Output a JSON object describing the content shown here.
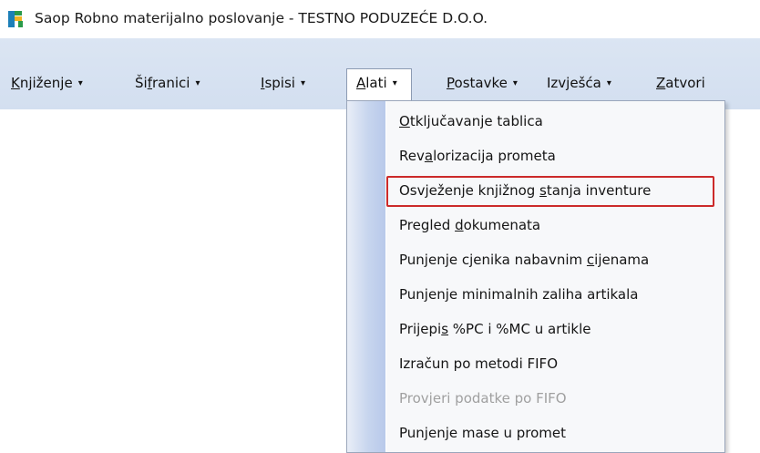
{
  "window": {
    "title": "Saop  Robno materijalno poslovanje - TESTNO PODUZEĆE D.O.O.",
    "accent_color": "#d6e1f1"
  },
  "menubar": {
    "items": [
      {
        "pre": "",
        "key": "K",
        "post": "njiženje",
        "arrow": "▾"
      },
      {
        "pre": "Ši",
        "key": "f",
        "post": "ranici",
        "arrow": "▾"
      },
      {
        "pre": "",
        "key": "I",
        "post": "spisi",
        "arrow": "▾"
      },
      {
        "pre": "",
        "key": "A",
        "post": "lati",
        "arrow": "▾"
      },
      {
        "pre": "",
        "key": "P",
        "post": "ostavke",
        "arrow": "▾"
      },
      {
        "pre": "Izvješća",
        "key": "",
        "post": "",
        "arrow": "▾"
      },
      {
        "pre": "",
        "key": "Z",
        "post": "atvori",
        "arrow": ""
      }
    ]
  },
  "dropdown": {
    "items": [
      {
        "pre": "",
        "key": "O",
        "post": "tključavanje tablica",
        "disabled": false
      },
      {
        "pre": "Rev",
        "key": "a",
        "post": "lorizacija prometa",
        "disabled": false
      },
      {
        "pre": "Osvježenje knjižnog ",
        "key": "s",
        "post": "tanja inventure",
        "disabled": false,
        "highlighted": true
      },
      {
        "pre": "Pregled ",
        "key": "d",
        "post": "okumenata",
        "disabled": false
      },
      {
        "pre": "Punjenje cjenika nabavnim ",
        "key": "c",
        "post": "ijenama",
        "disabled": false
      },
      {
        "pre": "Punjenje minimalnih zaliha artikala",
        "key": "",
        "post": "",
        "disabled": false
      },
      {
        "pre": "Prijepi",
        "key": "s",
        "post": " %PC i %MC u artikle",
        "disabled": false
      },
      {
        "pre": "Izračun po metodi FIFO",
        "key": "",
        "post": "",
        "disabled": false
      },
      {
        "pre": "Provjeri podatke po FIFO",
        "key": "",
        "post": "",
        "disabled": true
      },
      {
        "pre": "Punjenje mase u promet",
        "key": "",
        "post": "",
        "disabled": false
      }
    ],
    "highlight_color": "#cc2a2a"
  }
}
